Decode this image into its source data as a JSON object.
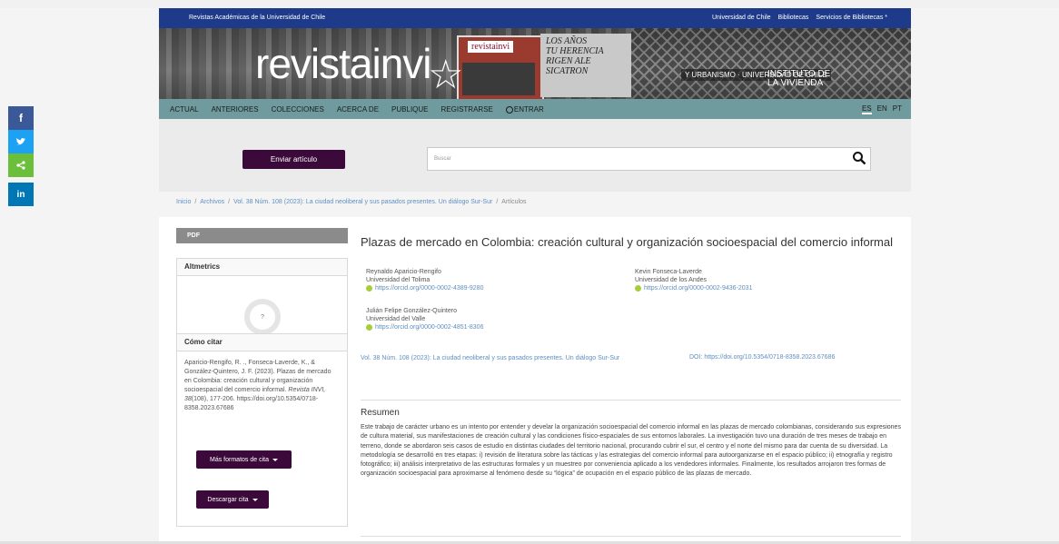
{
  "topbar": {
    "left_text": "Revistas Académicas de la Universidad de Chile",
    "links": [
      "Universidad de Chile",
      "Bibliotecas",
      "Servicios de Bibliotecas *"
    ]
  },
  "banner": {
    "logo_text": "revistainvi",
    "card_text": "revistainvi",
    "graffiti_lines": [
      "LOS AÑOS",
      "TU HERENCIA",
      "RIGEN ALE",
      "SICATRON"
    ],
    "institute_left": "Y URBANISMO · UNIVERSIDAD DE CHILE",
    "institute_right_1": "INSTITUTO DE",
    "institute_right_2": "LA VIVIENDA"
  },
  "nav": {
    "items": [
      "ACTUAL",
      "ANTERIORES",
      "COLECCIONES",
      "ACERCA DE",
      "PUBLIQUE",
      "REGISTRARSE"
    ],
    "login": "ENTRAR",
    "languages": [
      "ES",
      "EN",
      "PT"
    ],
    "active_language": "ES"
  },
  "actions": {
    "submit_label": "Enviar artículo",
    "search_placeholder": "Buscar"
  },
  "share": {
    "items": [
      {
        "name": "facebook",
        "glyph": "f",
        "color": "#3b5998"
      },
      {
        "name": "twitter",
        "glyph": "🐦",
        "color": "#1da1f2"
      },
      {
        "name": "share",
        "glyph": "<",
        "color": "#6bbf3b"
      },
      {
        "name": "linkedin",
        "glyph": "in",
        "color": "#0077b5"
      }
    ]
  },
  "breadcrumb": {
    "items": [
      "Inicio",
      "Archivos",
      "Vol. 38 Núm. 108 (2023): La ciudad neoliberal y sus pasados presentes. Un diálogo Sur-Sur"
    ],
    "current": "Artículos"
  },
  "sidebar": {
    "pdf_label": "PDF",
    "altmetrics_title": "Altmetrics",
    "altmetric_score": "?",
    "cite_title": "Cómo citar",
    "citation_text": "Aparicio-Rengifo, R. ., Fonseca-Laverde, K., & González-Quintero, J. F. (2023). Plazas de mercado en Colombia: creación cultural y organización socioespacial del comercio informal.",
    "citation_journal": "Revista INVI, 38",
    "citation_rest": "(108), 177-206. https://doi.org/10.5354/0718-8358.2023.67686",
    "more_formats_label": "Más formatos de cita",
    "download_label": "Descargar cita"
  },
  "article": {
    "title": "Plazas de mercado en Colombia: creación cultural y organización socioespacial del comercio informal",
    "authors": [
      {
        "name": "Reynaldo Aparicio-Rengifo",
        "affiliation": "Universidad del Tolima",
        "orcid": "https://orcid.org/0000-0002-4389-9280"
      },
      {
        "name": "Kevin Fonseca-Laverde",
        "affiliation": "Universidad de los Andes",
        "orcid": "https://orcid.org/0000-0002-9436-2031"
      },
      {
        "name": "Julián Felipe González-Quintero",
        "affiliation": "Universidad del Valle",
        "orcid": "https://orcid.org/0000-0002-4851-8306"
      }
    ],
    "issue": "Vol. 38 Núm. 108 (2023): La ciudad neoliberal y sus pasados presentes. Un diálogo Sur-Sur",
    "doi": "DOI: https://doi.org/10.5354/0718-8358.2023.67686",
    "abstract_title": "Resumen",
    "abstract": "Este trabajo de carácter urbano es un intento por entender y develar la organización socioespacial del comercio informal en las plazas de mercado colombianas, considerando sus expresiones de cultura material, sus manifestaciones de creación cultural y las condiciones físico-espaciales de sus entornos laborales. La investigación tuvo una duración de tres meses de trabajo en terreno, donde se abordaron seis casos de estudio en distintas ciudades del territorio nacional, procurando cubrir el sur, el centro y el norte del mismo para dar cuenta de su diversidad. La metodología se desarrolló en tres etapas: i) revisión de literatura sobre las tácticas y las estrategias del comercio informal para autoorganizarse en el espacio público; ii) etnografía y registro fotográfico; iii) análisis interpretativo de las estructuras formales y un muestreo por conveniencia aplicado a los vendedores informales. Finalmente, los resultados arrojaron tres formas de organización socioespacial para aproximarse al fenómeno desde su “lógica” de ocupación en el espacio público de las plazas de mercado."
  }
}
